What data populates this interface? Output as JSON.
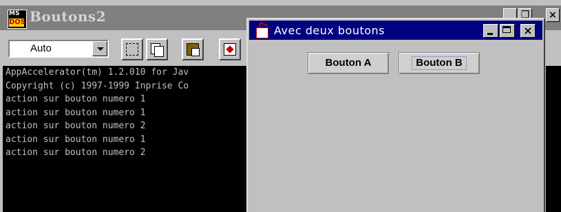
{
  "console": {
    "title": "Boutons2",
    "logo_top": "MS",
    "logo_bottom": "DOS",
    "combo_value": "Auto",
    "lines": [
      "AppAccelerator(tm) 1.2.010 for Jav",
      "Copyright (c) 1997-1999 Inprise Co",
      "action sur bouton numero 1",
      "action sur bouton numero 1",
      "action sur bouton numero 2",
      "action sur bouton numero 1",
      "action sur bouton numero 2"
    ],
    "ctrl_minimize": "_",
    "ctrl_restore": "❒",
    "ctrl_close": "×"
  },
  "window": {
    "title": "Avec deux boutons",
    "close_glyph": "×",
    "buttons": [
      "Bouton A",
      "Bouton B"
    ]
  },
  "icons": [
    "ms-dos-icon",
    "chevron-down-icon",
    "mark-icon",
    "copy-icon",
    "paste-icon",
    "fullscreen-icon",
    "java-cup-icon"
  ]
}
